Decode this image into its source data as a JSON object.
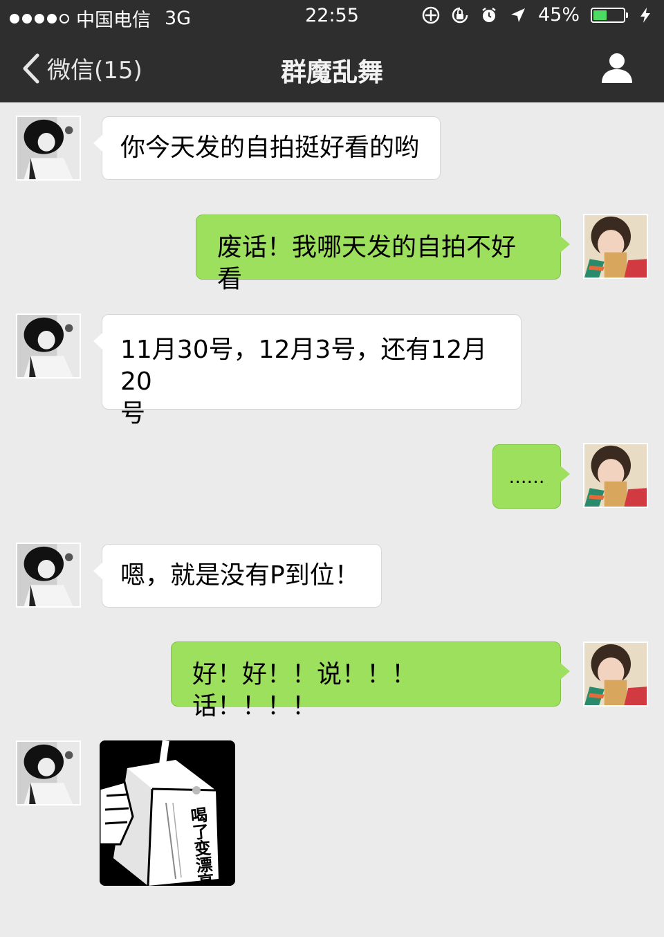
{
  "status_bar": {
    "carrier": "中国电信",
    "network": "3G",
    "time": "22:55",
    "battery_percent_label": "45%",
    "battery_level": 0.45,
    "icons": [
      "signal-dots-icon",
      "location-service-icon",
      "rotation-lock-icon",
      "alarm-icon",
      "location-arrow-icon",
      "battery-icon",
      "charging-bolt-icon"
    ]
  },
  "nav": {
    "back_label": "微信(15)",
    "title": "群魔乱舞",
    "icons": [
      "back-chevron-icon",
      "profile-icon"
    ]
  },
  "messages": [
    {
      "from": "friend",
      "text": "你今天发的自拍挺好看的哟"
    },
    {
      "from": "me",
      "text": "废话！我哪天发的自拍不好看"
    },
    {
      "from": "friend",
      "text_line1": "11月30号，12月3号，还有12月20",
      "text_line2": "号"
    },
    {
      "from": "me",
      "text": "……"
    },
    {
      "from": "friend",
      "text": "嗯，就是没有P到位！"
    },
    {
      "from": "me",
      "text": "好！好！！说！！！话！！！！"
    },
    {
      "from": "friend",
      "type": "sticker",
      "sticker_text": "喝了变漂亮"
    }
  ],
  "colors": {
    "bar_bg": "#2e2e2e",
    "chat_bg": "#ebebeb",
    "out_bubble": "#9de05d",
    "in_bubble": "#ffffff",
    "battery_green": "#4cd964"
  }
}
